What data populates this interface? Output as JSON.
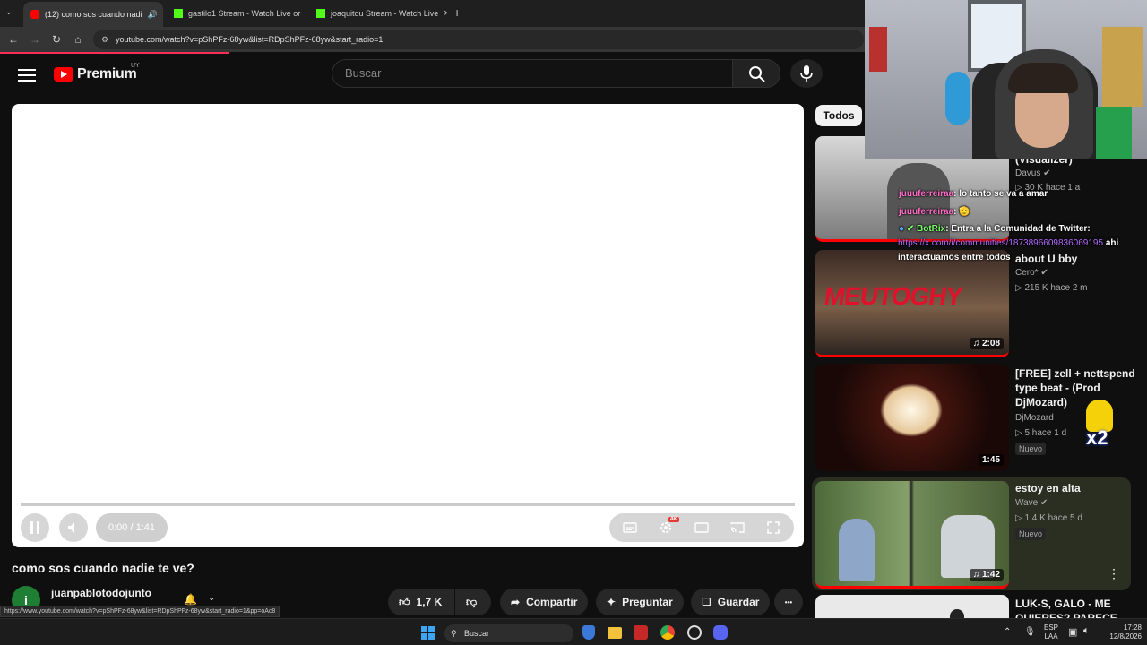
{
  "browser": {
    "tabs": [
      {
        "label": "(12) como sos cuando nadi",
        "active": true
      },
      {
        "label": "gastilo1 Stream - Watch Live or",
        "active": false
      },
      {
        "label": "joaquitou Stream - Watch Live",
        "active": false
      }
    ],
    "new_tab": "+",
    "url": "youtube.com/watch?v=pShPFz-68yw&list=RDpShPFz-68yw&start_radio=1",
    "status_url": "https://www.youtube.com/watch?v=pShPFz-68yw&list=RDpShPFz-68yw&start_radio=1&pp=oAc8"
  },
  "header": {
    "logo": "Premium",
    "country": "UY",
    "search_placeholder": "Buscar"
  },
  "player": {
    "time": "0:00 / 1:41",
    "hd_badge": "4K"
  },
  "video": {
    "title": "como sos cuando nadie te ve?",
    "channel_initial": "i",
    "channel": "juanpablotodojunto",
    "likes": "1,7 K",
    "share": "Compartir",
    "ask": "Preguntar",
    "save": "Guardar",
    "more": "•••"
  },
  "sidebar": {
    "chip": "Todos",
    "items": [
      {
        "title": "(Visualizer)",
        "channel": "Davus",
        "meta": "30 K   hace 1 a"
      },
      {
        "title": "about       U       bby",
        "channel": "Cero*",
        "meta": "215 K   hace 2 m",
        "duration": "2:08",
        "art": "MEUTOGHY"
      },
      {
        "title": "[FREE] zell + nettspend type beat - (Prod DjMozard)",
        "channel": "DjMozard",
        "meta": "5   hace 1 d",
        "badge": "Nuevo",
        "duration": "1:45"
      },
      {
        "title": "estoy en alta",
        "channel": "Wave",
        "meta": "1,4 K   hace 5 d",
        "badge": "Nuevo",
        "duration": "1:42"
      },
      {
        "title": "LUK-S, GALO - ME QUIERES? PARECE QUE"
      }
    ]
  },
  "chat": [
    {
      "user": "juuuferreiraa",
      "text": ": lo tanto se va a amar",
      "color": "#ff6ec7"
    },
    {
      "user": "juuuferreiraa",
      "text": ": 🫡",
      "color": "#ff6ec7"
    },
    {
      "user": "BotRix",
      "text": ": Entra a la Comunidad de Twitter:",
      "color": "#7cff6b"
    },
    {
      "link": "https://x.com/i/communities/1873896609836069195",
      "tail": " ahi"
    },
    {
      "text": "interactuamos entre todos"
    }
  ],
  "overlay_badge": "x2",
  "taskbar": {
    "search": "Buscar",
    "lang1": "ESP",
    "lang2": "LAA",
    "time": "17:28",
    "date": "12/8/2026"
  },
  "colors": {
    "youtube_red": "#ff0000",
    "chat_pink": "#ff6ec7",
    "chat_green": "#7cff6b",
    "chat_link": "#b36bff"
  }
}
